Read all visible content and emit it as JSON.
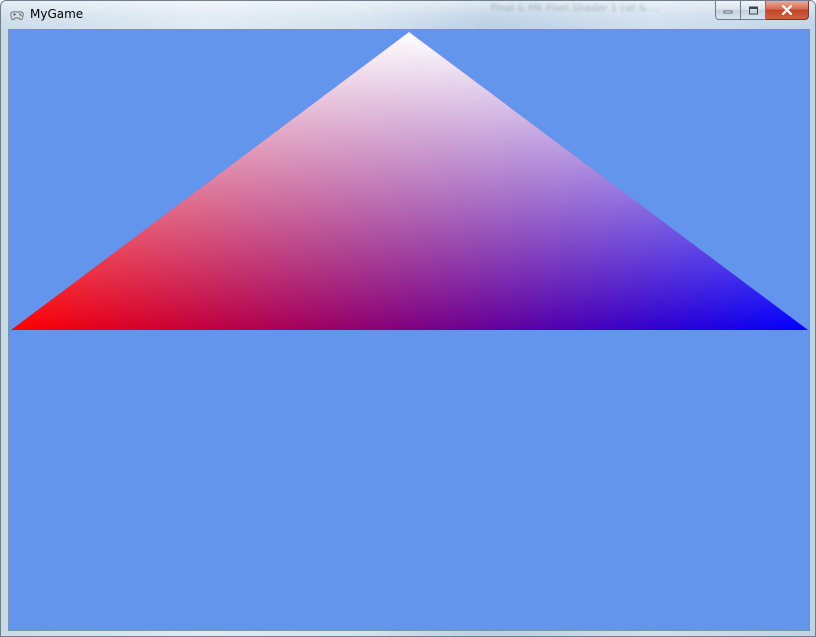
{
  "window": {
    "title": "MyGame",
    "app_icon": "gamepad-icon",
    "background_title_text": "Final & Mk Pixel Shader 1 cat & ..."
  },
  "controls": {
    "minimize_icon": "minimize-icon",
    "maximize_icon": "maximize-icon",
    "close_icon": "close-icon"
  },
  "scene": {
    "clear_color": "#6495ed",
    "triangle_vertex_colors": {
      "top": "#ffffff",
      "left": "#ff0000",
      "right": "#0000ff"
    }
  }
}
